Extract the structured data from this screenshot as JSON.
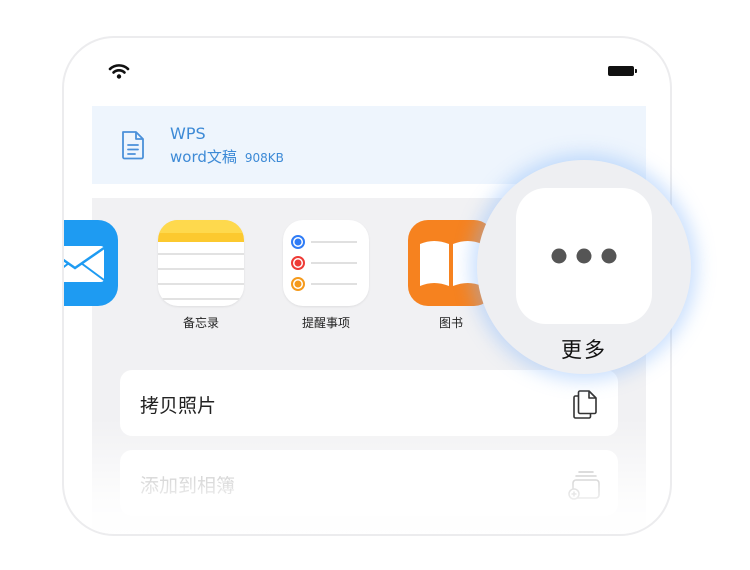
{
  "status_bar": {
    "wifi_icon": "wifi-icon",
    "battery_icon": "battery-full-icon"
  },
  "file": {
    "name": "WPS",
    "type": "word文稿",
    "size": "908KB",
    "icon": "document-icon"
  },
  "apps": [
    {
      "label": "",
      "icon": "mail-icon"
    },
    {
      "label": "备忘录",
      "icon": "notes-icon"
    },
    {
      "label": "提醒事项",
      "icon": "reminders-icon"
    },
    {
      "label": "图书",
      "icon": "books-icon"
    }
  ],
  "more": {
    "label": "更多",
    "icon": "ellipsis-icon"
  },
  "actions": [
    {
      "label": "拷贝照片",
      "icon": "copy-icon"
    },
    {
      "label": "添加到相簿",
      "icon": "add-to-album-icon"
    }
  ],
  "colors": {
    "accent": "#3d8ad6",
    "file_card_bg": "#eef5fd",
    "sheet_bg": "#f1f1f3",
    "books": "#f6821f",
    "mail": "#1e9bf2",
    "magnifier_glow": "#87b9fa"
  }
}
